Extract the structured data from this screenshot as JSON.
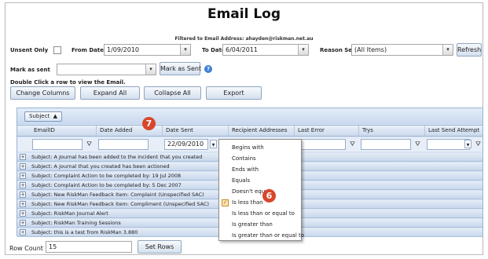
{
  "page": {
    "title": "Email Log",
    "subtitle": "Filtered to Email Address: ahayden@riskman.net.au"
  },
  "filters": {
    "unsent_only_label": "Unsent Only",
    "from_date_label": "From Date",
    "from_date_value": "1/09/2010",
    "to_date_label": "To Date",
    "to_date_value": "6/04/2011",
    "reason_sent_label": "Reason Sent",
    "reason_sent_value": "(All Items)",
    "refresh_label": "Refresh"
  },
  "mark": {
    "label": "Mark as sent",
    "value": "",
    "button_label": "Mark as Sent"
  },
  "hint": "Double Click a row to view the Email.",
  "toolbar": {
    "change_columns": "Change Columns",
    "expand_all": "Expand All",
    "collapse_all": "Collapse All",
    "export": "Export"
  },
  "grid": {
    "group_chip": "Subject",
    "group_chip_icon": "sort-ascending-icon",
    "columns": [
      "EmailID",
      "Date Added",
      "Date Sent",
      "Recipient Addresses",
      "Last Error",
      "Trys",
      "Last Send Attempt"
    ],
    "filter_date_sent_value": "22/09/2010",
    "rows": [
      "Subject: A Journal has been added to the incident that you created",
      "Subject: A journal that you created has been actioned",
      "Subject: Complaint Action to be completed by: 19 Jul 2008",
      "Subject: Complaint Action to be completed by: 5 Dec 2007",
      "Subject: New RiskMan Feedback Item: Complaint (Unspecified SAC)",
      "Subject: New RiskMan Feedback Item: Compliment (Unspecified SAC)",
      "Subject: RiskMan Journal Alert",
      "Subject: RiskMan Training Sessions",
      "Subject: this is a test from RiskMan 3.880"
    ]
  },
  "filter_menu": {
    "items": [
      "Begins with",
      "Contains",
      "Ends with",
      "Equals",
      "Doesn't equal",
      "Is less than",
      "Is less than or equal to",
      "Is greater than",
      "Is greater than or equal to"
    ],
    "selected": "Is less than"
  },
  "footer": {
    "row_count_label": "Row Count",
    "row_count_value": "15",
    "set_rows_label": "Set Rows"
  },
  "callouts": {
    "step_7": "7",
    "step_6": "6"
  },
  "colors": {
    "accent": "#3d7fd6",
    "callout": "#d8472a",
    "grid_row": "#c9d8ec"
  }
}
